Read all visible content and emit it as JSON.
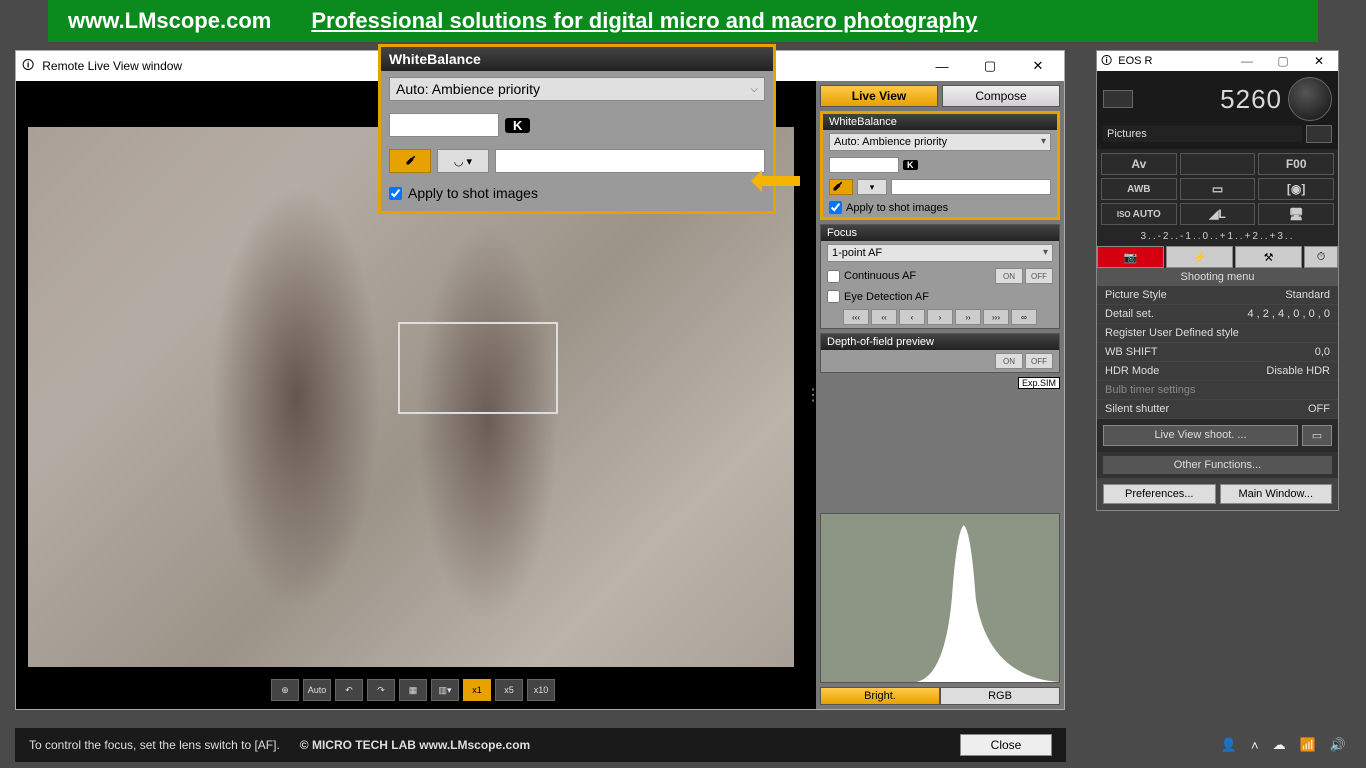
{
  "banner": {
    "url": "www.LMscope.com",
    "tagline": "Professional solutions for digital micro and macro photography"
  },
  "liveview": {
    "title": "Remote Live View window",
    "tabs": {
      "live": "Live View",
      "compose": "Compose"
    },
    "wb": {
      "title": "WhiteBalance",
      "mode": "Auto: Ambience priority",
      "k_label": "K",
      "apply": "Apply to shot images"
    },
    "focus": {
      "title": "Focus",
      "mode": "1-point AF",
      "continuous": "Continuous AF",
      "eye": "Eye Detection AF",
      "on": "ON",
      "off": "OFF",
      "inf": "∞"
    },
    "dof": {
      "title": "Depth-of-field preview",
      "on": "ON",
      "off": "OFF"
    },
    "expsim": "Exp.SIM",
    "hist": {
      "bright": "Bright.",
      "rgb": "RGB"
    },
    "zoom": {
      "auto": "Auto",
      "x1": "x1",
      "x5": "x5",
      "x10": "x10"
    }
  },
  "eos": {
    "title": "EOS R",
    "count": "5260",
    "pictures": "Pictures",
    "grid": {
      "av": "Av",
      "f": "F00",
      "awb": "AWB",
      "auto": "AUTO",
      "iso": "ISO"
    },
    "scale": "3..-2..-1..0..+1..+2..+3..",
    "shooting_menu": "Shooting menu",
    "items": [
      {
        "k": "Picture Style",
        "v": "Standard"
      },
      {
        "k": "Detail set.",
        "v": "4 , 2 , 4 , 0 , 0 , 0"
      },
      {
        "k": "Register User Defined style",
        "v": ""
      },
      {
        "k": "WB SHIFT",
        "v": "0,0"
      },
      {
        "k": "HDR Mode",
        "v": "Disable HDR"
      },
      {
        "k": "Bulb timer settings",
        "v": "",
        "dis": true
      },
      {
        "k": "Silent shutter",
        "v": "OFF"
      }
    ],
    "live_shoot": "Live View shoot. ...",
    "other": "Other Functions...",
    "prefs": "Preferences...",
    "main": "Main Window..."
  },
  "footer": {
    "hint": "To control the focus, set the lens switch to [AF].",
    "credit": "©  MICRO TECH LAB    www.LMscope.com",
    "close": "Close"
  }
}
